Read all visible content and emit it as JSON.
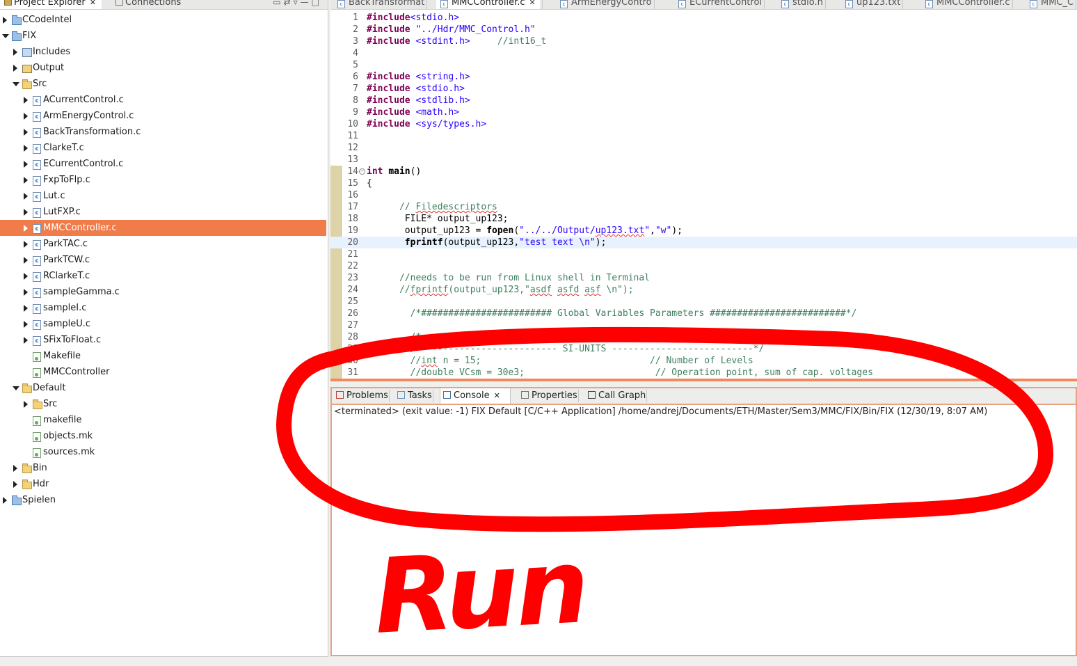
{
  "explorer": {
    "tab_title": "Project Explorer",
    "tab_close": "✕",
    "other_tab": "Connections",
    "tree": [
      {
        "label": "CCodeIntel",
        "icon": "c-project-icon",
        "indent": 0,
        "arrow": "closed"
      },
      {
        "label": "FIX",
        "icon": "c-project-icon",
        "indent": 0,
        "arrow": "open"
      },
      {
        "label": "Includes",
        "icon": "includes-icon",
        "indent": 1,
        "arrow": "closed"
      },
      {
        "label": "Output",
        "icon": "output-folder-icon",
        "indent": 1,
        "arrow": "closed"
      },
      {
        "label": "Src",
        "icon": "folder-icon",
        "indent": 1,
        "arrow": "open"
      },
      {
        "label": "ACurrentControl.c",
        "icon": "c-file-icon",
        "indent": 2,
        "arrow": "closed"
      },
      {
        "label": "ArmEnergyControl.c",
        "icon": "c-file-icon",
        "indent": 2,
        "arrow": "closed"
      },
      {
        "label": "BackTransformation.c",
        "icon": "c-file-icon",
        "indent": 2,
        "arrow": "closed"
      },
      {
        "label": "ClarkeT.c",
        "icon": "c-file-icon",
        "indent": 2,
        "arrow": "closed"
      },
      {
        "label": "ECurrentControl.c",
        "icon": "c-file-icon",
        "indent": 2,
        "arrow": "closed"
      },
      {
        "label": "FxpToFlp.c",
        "icon": "c-file-icon",
        "indent": 2,
        "arrow": "closed"
      },
      {
        "label": "Lut.c",
        "icon": "c-file-icon",
        "indent": 2,
        "arrow": "closed"
      },
      {
        "label": "LutFXP.c",
        "icon": "c-file-icon",
        "indent": 2,
        "arrow": "closed"
      },
      {
        "label": "MMCController.c",
        "icon": "c-file-icon",
        "indent": 2,
        "arrow": "closed",
        "selected": true
      },
      {
        "label": "ParkTAC.c",
        "icon": "c-file-icon",
        "indent": 2,
        "arrow": "closed"
      },
      {
        "label": "ParkTCW.c",
        "icon": "c-file-icon",
        "indent": 2,
        "arrow": "closed"
      },
      {
        "label": "RClarkeT.c",
        "icon": "c-file-icon",
        "indent": 2,
        "arrow": "closed"
      },
      {
        "label": "sampleGamma.c",
        "icon": "c-file-icon",
        "indent": 2,
        "arrow": "closed"
      },
      {
        "label": "sampleI.c",
        "icon": "c-file-icon",
        "indent": 2,
        "arrow": "closed"
      },
      {
        "label": "sampleU.c",
        "icon": "c-file-icon",
        "indent": 2,
        "arrow": "closed"
      },
      {
        "label": "SFixToFloat.c",
        "icon": "c-file-icon",
        "indent": 2,
        "arrow": "closed"
      },
      {
        "label": "Makefile",
        "icon": "make-file-icon",
        "indent": 2,
        "arrow": "none"
      },
      {
        "label": "MMCController",
        "icon": "make-file-icon",
        "indent": 2,
        "arrow": "none"
      },
      {
        "label": "Default",
        "icon": "folder-icon",
        "indent": 1,
        "arrow": "open"
      },
      {
        "label": "Src",
        "icon": "folder-icon",
        "indent": 2,
        "arrow": "closed"
      },
      {
        "label": "makefile",
        "icon": "make-file-icon",
        "indent": 2,
        "arrow": "none"
      },
      {
        "label": "objects.mk",
        "icon": "make-file-icon",
        "indent": 2,
        "arrow": "none"
      },
      {
        "label": "sources.mk",
        "icon": "make-file-icon",
        "indent": 2,
        "arrow": "none"
      },
      {
        "label": "Bin",
        "icon": "folder-icon",
        "indent": 1,
        "arrow": "closed"
      },
      {
        "label": "Hdr",
        "icon": "folder-icon",
        "indent": 1,
        "arrow": "closed"
      },
      {
        "label": "Spielen",
        "icon": "c-project-icon",
        "indent": 0,
        "arrow": "closed"
      }
    ]
  },
  "editor": {
    "tabs": [
      {
        "label": "BackTransformat",
        "active": false
      },
      {
        "label": "MMCController.c",
        "active": true,
        "close": "✕"
      },
      {
        "label": "ArmEnergyContro",
        "active": false
      },
      {
        "label": "ECurrentControl",
        "active": false
      },
      {
        "label": "stdio.h",
        "active": false
      },
      {
        "label": "up123.txt",
        "active": false
      },
      {
        "label": "MMCController.c",
        "active": false
      },
      {
        "label": "MMC_C",
        "active": false
      }
    ],
    "lines": [
      {
        "n": "1",
        "html": "<span class='pp'>#include</span><span class='str'>&lt;stdio.h&gt;</span>"
      },
      {
        "n": "2",
        "html": "<span class='pp'>#include</span> <span class='str'>\"../Hdr/MMC_Control.h\"</span>"
      },
      {
        "n": "3",
        "html": "<span class='pp'>#include</span> <span class='str'>&lt;stdint.h&gt;</span>     <span class='cm'>//int16_t</span>"
      },
      {
        "n": "4",
        "html": ""
      },
      {
        "n": "5",
        "html": ""
      },
      {
        "n": "6",
        "html": "<span class='pp'>#include</span> <span class='str'>&lt;string.h&gt;</span>"
      },
      {
        "n": "7",
        "html": "<span class='pp'>#include</span> <span class='str'>&lt;stdio.h&gt;</span>"
      },
      {
        "n": "8",
        "html": "<span class='pp'>#include</span> <span class='str'>&lt;stdlib.h&gt;</span>"
      },
      {
        "n": "9",
        "html": "<span class='pp'>#include</span> <span class='str'>&lt;math.h&gt;</span>"
      },
      {
        "n": "10",
        "html": "<span class='pp'>#include</span> <span class='str'>&lt;sys/types.h&gt;</span>"
      },
      {
        "n": "11",
        "html": ""
      },
      {
        "n": "12",
        "html": ""
      },
      {
        "n": "13",
        "html": ""
      },
      {
        "n": "14",
        "html": "<span class='kw'>int</span> <span class='fn'>main</span>()",
        "fold": true
      },
      {
        "n": "15",
        "html": "{"
      },
      {
        "n": "16",
        "html": ""
      },
      {
        "n": "17",
        "html": "      <span class='cm'>// <span class='squig'>Filedescriptors</span></span>"
      },
      {
        "n": "18",
        "html": "       FILE* output_up123;"
      },
      {
        "n": "19",
        "html": "       output_up123 = <span class='fn'>fopen</span>(<span class='str'>\"../../Output/<span class='squig'>up123.txt</span>\"</span>,<span class='str'>\"w\"</span>);"
      },
      {
        "n": "20",
        "html": "       <span class='fn'>fprintf</span>(output_up123,<span class='str'>\"test text \\n\"</span>);",
        "highlight": true
      },
      {
        "n": "21",
        "html": ""
      },
      {
        "n": "22",
        "html": ""
      },
      {
        "n": "23",
        "html": "      <span class='cm'>//needs to be run from Linux shell in Terminal</span>"
      },
      {
        "n": "24",
        "html": "      <span class='cm'>//<span class='squig'>fprintf</span>(output_up123,\"<span class='squig'>asdf</span> <span class='squig'>asfd</span> <span class='squig'>asf</span> \\n\");</span>"
      },
      {
        "n": "25",
        "html": ""
      },
      {
        "n": "26",
        "html": "        <span class='cm'>/*######################## Global Variables Parameters #########################*/</span>"
      },
      {
        "n": "27",
        "html": ""
      },
      {
        "n": "28",
        "html": "        <span class='cm'>/*                          PARAMETERS                                    */</span>"
      },
      {
        "n": "29",
        "html": "        <span class='cm'>/*------------------------- SI-UNITS --------------------------*/</span>"
      },
      {
        "n": "30",
        "html": "        <span class='cm'>//<span class='squig'>int</span> n = 15;                               // Number of Levels</span>"
      },
      {
        "n": "31",
        "html": "        <span class='cm'>//double VCsm = 30e3;                        // Operation point, sum of cap. voltages</span>"
      }
    ]
  },
  "console": {
    "tabs": [
      {
        "label": "Problems",
        "icon": "problems-icon"
      },
      {
        "label": "Tasks",
        "icon": "tasks-icon"
      },
      {
        "label": "Console",
        "icon": "console-icon",
        "active": true,
        "close": "✕"
      },
      {
        "label": "Properties",
        "icon": "properties-icon"
      },
      {
        "label": "Call Graph",
        "icon": "call-graph-icon"
      }
    ],
    "status": "<terminated> (exit value: -1) FIX Default [C/C++ Application] /home/andrej/Documents/ETH/Master/Sem3/MMC/FIX/Bin/FIX (12/30/19, 8:07 AM)"
  },
  "annotation": {
    "text": "Run",
    "color": "#ff0000"
  }
}
